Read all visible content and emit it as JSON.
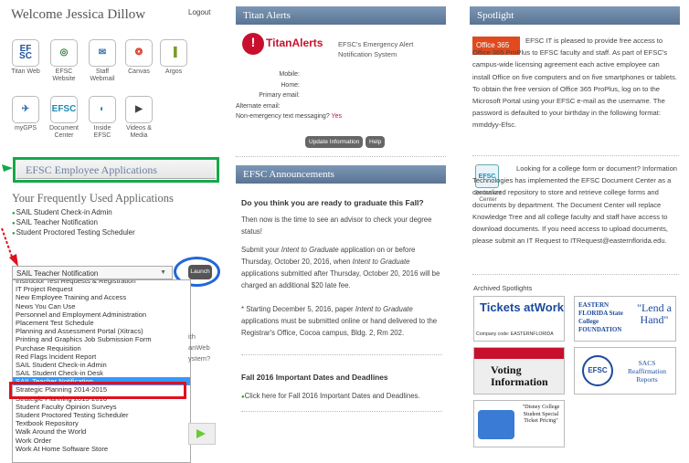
{
  "header": {
    "welcome": "Welcome Jessica Dillow",
    "logout": "Logout"
  },
  "apps": [
    {
      "label": "Titan Web",
      "icon": "titan-web-icon",
      "glyph": "EF SC",
      "color": "#1e4f9c"
    },
    {
      "label": "EFSC Website",
      "icon": "efsc-website-icon",
      "glyph": "◎",
      "color": "#2a7a3a"
    },
    {
      "label": "Staff Webmail",
      "icon": "staff-webmail-icon",
      "glyph": "✉",
      "color": "#2a6fb0"
    },
    {
      "label": "Canvas",
      "icon": "canvas-icon",
      "glyph": "❂",
      "color": "#d33a2a"
    },
    {
      "label": "Argos",
      "icon": "argos-icon",
      "glyph": "▐",
      "color": "#7a9a2a"
    },
    {
      "label": "myGPS",
      "icon": "mygps-icon",
      "glyph": "✈",
      "color": "#2a6fb0"
    },
    {
      "label": "Document Center",
      "icon": "document-center-icon",
      "glyph": "EFSC",
      "color": "#1e8bb5"
    },
    {
      "label": "Inside EFSC",
      "icon": "inside-efsc-icon",
      "glyph": "◐",
      "color": "#2a8ab5"
    },
    {
      "label": "Videos & Media",
      "icon": "videos-media-icon",
      "glyph": "▶",
      "color": "#444444"
    }
  ],
  "employee": {
    "title": "EFSC Employee Applications",
    "frequent_title": "Your Frequently Used Applications",
    "frequent": [
      "SAIL Student Check-in Admin",
      "SAIL Teacher Notification",
      "Student Proctored Testing Scheduler"
    ],
    "select_value": "SAIL Teacher Notification",
    "launch": "Launch",
    "options": [
      "Instructor Test Requests & Registration",
      "IT Project Request",
      "New Employee Training and Access",
      "News You Can Use",
      "Personnel and Employment Administration",
      "Placement Test Schedule",
      "Planning and Assessment Portal (Xitracs)",
      "Printing and Graphics Job Submission Form",
      "Purchase Requisition",
      "Red Flags Incident Report",
      "SAIL Student Check-in Admin",
      "SAIL Student Check-in Desk",
      "SAIL Teacher Notification",
      "Strategic Planning 2014-2015",
      "Strategic Planning 2015-2016",
      "Student Faculty Opinion Surveys",
      "Student Proctored Testing Scheduler",
      "Textbook Repository",
      "Walk Around the World",
      "Work Order",
      "Work At Home Software Store"
    ],
    "selected_index": 12,
    "partial_text": [
      "ith",
      "anWeb",
      "ystem?"
    ]
  },
  "alerts": {
    "title": "Titan Alerts",
    "logo_text": "TitanAlerts",
    "desc": "EFSC's Emergency Alert Notification System",
    "fields": [
      "Mobile:",
      "Home:",
      "Primary email:",
      "Alternate email:"
    ],
    "non_emergency": "Non-emergency text messaging?",
    "non_emergency_value": "Yes",
    "update_button": "Update Information",
    "help_button": "Help"
  },
  "announcements": {
    "title": "EFSC Announcements",
    "question": "Do you think you are ready to graduate this Fall?",
    "para1": "Then now is the time to see an advisor to check your degree status!",
    "para2_a": "Submit your ",
    "para2_i1": "Intent to Graduate",
    "para2_b": " application on or before Thursday, October 20, 2016, when ",
    "para2_i2": "Intent to Graduate",
    "para2_c": " applications submitted after Thursday, October 20, 2016 will be charged an additional $20 late fee.",
    "para3_a": "* Starting December 5, 2016, paper ",
    "para3_i": "Intent to Graduate",
    "para3_b": " applications must be submitted online or hand delivered to the Registrar's Office, Cocoa campus, Bldg. 2, Rm 202.",
    "dates_title": "Fall 2016 Important Dates and Deadlines",
    "dates_link": "Click here for Fall 2016 Important Dates and Deadlines."
  },
  "spotlight": {
    "title": "Spotlight",
    "office_logo": "Office 365",
    "office_text": "EFSC IT is pleased to provide free access to Office 365 ProPlus to EFSC faculty and staff. As part of EFSC's campus-wide licensing agreement each active employee can install Office on five computers and on five smartphones or tablets. To obtain the free version of Office 365 ProPlus, log on to the Microsoft Portal using your EFSC e-mail as the username. The password is defaulted to your birthday in the following format: mmddyy-Efsc.",
    "doc_label": "Document Center",
    "doc_text": "Looking for a college form or document? Information Technologies has implemented the EFSC Document Center as a centralized repository to store and retrieve college forms and documents by department. The Document Center will replace Knowledge Tree and all college faculty and staff have access to download documents. If you need access to upload documents, please submit an IT Request to ITRequest@easternflorida.edu.",
    "archived_title": "Archived Spotlights",
    "tickets": "Tickets atWork",
    "tickets_code": "Company code: EASTERNFLORIDA",
    "foundation": "EASTERN FLORIDA State College FOUNDATION",
    "lend_hand": "\"Lend a Hand\"",
    "voting": "Voting Information",
    "sacs": "SACS Reaffirmation Reports",
    "disney": "\"Disney College Student Special Ticket Pricing\""
  }
}
